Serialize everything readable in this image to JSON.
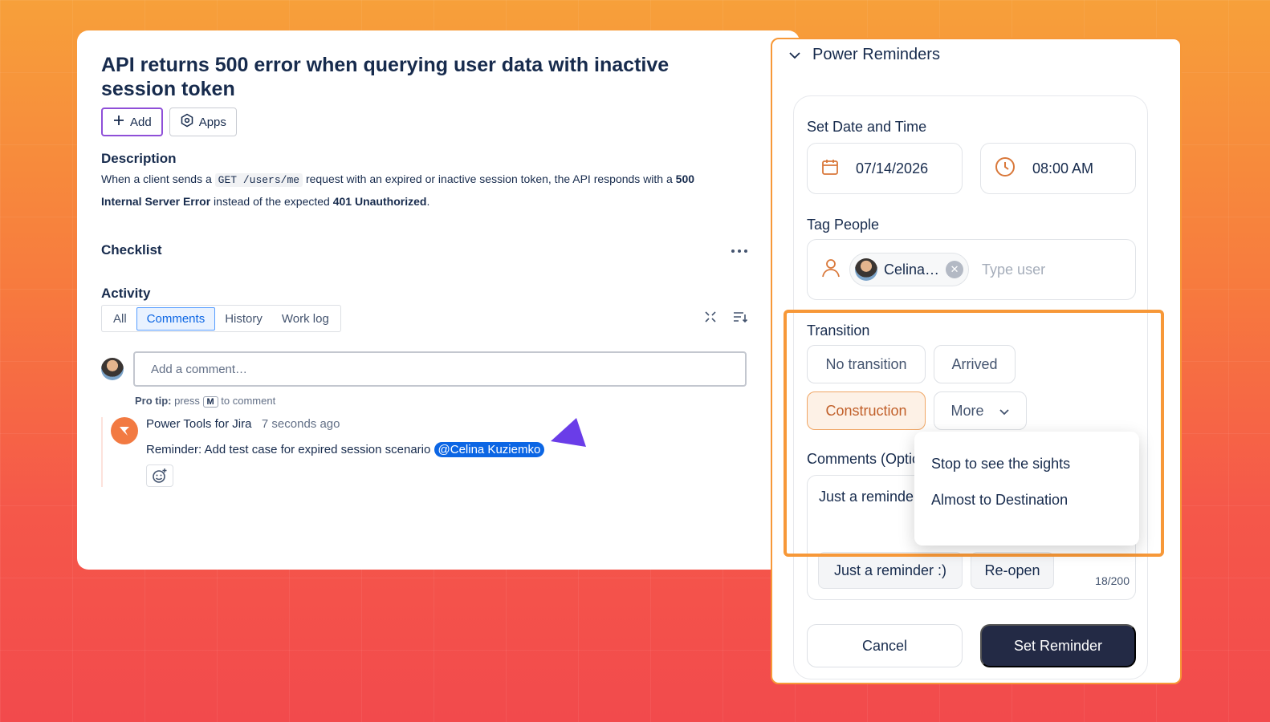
{
  "issue": {
    "title": "API returns 500 error when querying user data with inactive session token",
    "add_label": "Add",
    "apps_label": "Apps",
    "description_heading": "Description",
    "description": {
      "part1": "When a client sends a ",
      "code": "GET /users/me",
      "part2": " request with an expired or inactive session token, the API responds with a ",
      "bold1": "500 Internal Server Error",
      "part3": " instead of the expected ",
      "bold2": "401 Unauthorized",
      "part4": "."
    },
    "checklist_heading": "Checklist",
    "activity_heading": "Activity",
    "tabs": [
      {
        "label": "All"
      },
      {
        "label": "Comments"
      },
      {
        "label": "History"
      },
      {
        "label": "Work log"
      }
    ],
    "comment_placeholder": "Add a comment…",
    "protip": {
      "prefix": "Pro tip:",
      "middle": " press ",
      "key": "M",
      "suffix": " to comment"
    },
    "comment": {
      "author": "Power Tools for Jira",
      "time": "7 seconds ago",
      "text": "Reminder: Add test case for expired session scenario ",
      "mention": "@Celina Kuziemko"
    }
  },
  "panel": {
    "title": "Power Reminders",
    "date_time_label": "Set Date and Time",
    "date": "07/14/2026",
    "time": "08:00 AM",
    "tag_label": "Tag People",
    "tagged_user": "Celina…",
    "user_placeholder": "Type user",
    "transition_label": "Transition",
    "transitions": {
      "no_transition": "No transition",
      "arrived": "Arrived",
      "construction": "Construction",
      "more": "More"
    },
    "comments_label": "Comments (Optic",
    "comment_text": "Just a reminder",
    "quick_1": "Just a reminder :)",
    "quick_2": "Re-open",
    "counter": "18/200",
    "cancel": "Cancel",
    "set": "Set Reminder",
    "more_options": [
      {
        "label": "Stop to see the sights"
      },
      {
        "label": "Almost to Destination"
      }
    ]
  },
  "colors": {
    "accent_orange": "#f79838",
    "primary_dark": "#232a45",
    "jira_blue": "#0c66e4"
  }
}
